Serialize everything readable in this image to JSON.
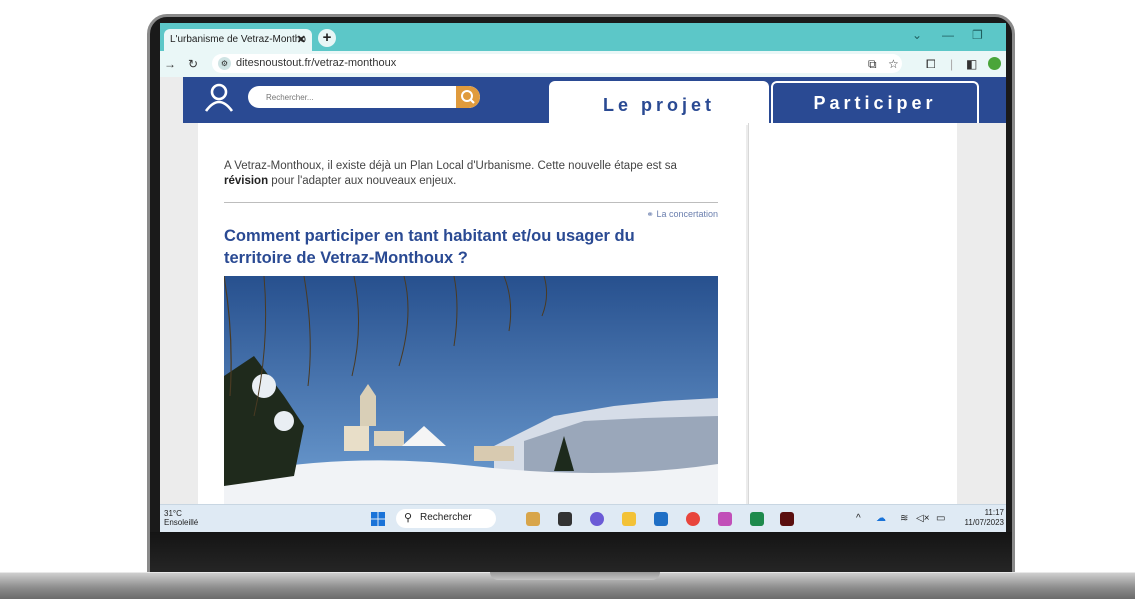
{
  "browser": {
    "tab_title": "L'urbanisme de Vetraz-Montho",
    "tab_close": "✕",
    "new_tab": "+",
    "url": "ditesnoustout.fr/vetraz-monthoux"
  },
  "site": {
    "search_placeholder": "Rechercher...",
    "tabs": [
      {
        "label": "Le projet"
      },
      {
        "label": "Participer"
      }
    ]
  },
  "article": {
    "intro_text": "A Vetraz-Monthoux, il existe déjà un Plan Local d'Urbanisme. Cette nouvelle étape est sa",
    "intro_bold": "révision",
    "intro_rest": " pour l'adapter aux nouveaux enjeux.",
    "tag": "La concertation",
    "title": "Comment participer en tant habitant et/ou usager du territoire de Vetraz-Monthoux ?"
  },
  "taskbar": {
    "weather_temp": "31°C",
    "weather_desc": "Ensoleillé",
    "search_label": "Rechercher",
    "time": "11:17",
    "date": "11/07/2023"
  }
}
